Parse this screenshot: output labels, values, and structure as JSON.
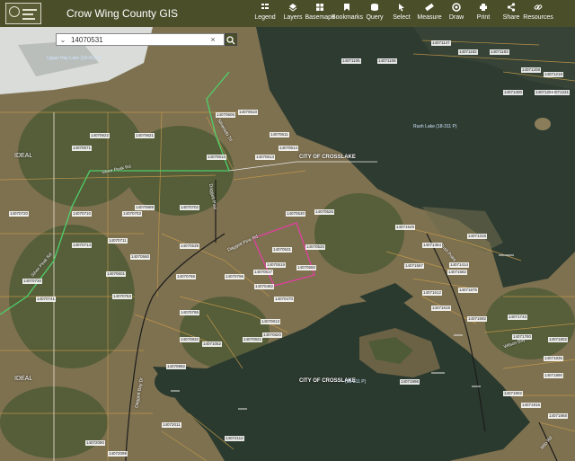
{
  "header": {
    "title": "Crow Wing County GIS",
    "tools": [
      {
        "label": "Legend",
        "icon": "legend-icon"
      },
      {
        "label": "Layers",
        "icon": "layers-icon"
      },
      {
        "label": "Basemaps",
        "icon": "basemaps-icon"
      },
      {
        "label": "Bookmarks",
        "icon": "bookmarks-icon"
      },
      {
        "label": "Query",
        "icon": "query-icon"
      },
      {
        "label": "Select",
        "icon": "select-icon"
      },
      {
        "label": "Measure",
        "icon": "measure-icon"
      },
      {
        "label": "Draw",
        "icon": "draw-icon"
      },
      {
        "label": "Print",
        "icon": "print-icon"
      },
      {
        "label": "Share",
        "icon": "share-icon"
      },
      {
        "label": "Resources",
        "icon": "resources-icon"
      }
    ]
  },
  "search": {
    "value": "14070531"
  },
  "map": {
    "labels": {
      "city_north": "CITY OF CROSSLAKE",
      "city_south": "CITY OF CROSSLAKE",
      "ideal_north": "IDEAL",
      "ideal_south": "IDEAL",
      "lake_east": "Rush Lake (18-311 P)",
      "lake_south": "(18-311 P)",
      "lake_nw": "Upper Hay Lake (18-412 P)",
      "road_silver_peak": "Silver Peak Rd",
      "road_silver_peak_sw": "Silver Peak Rd",
      "road_nw": "Silverado Trl",
      "road_mid": "Daggett Pine Rd",
      "road_mid2": "Daggett Pine",
      "road_west": "Daggett Bay Dr",
      "road_island": "Rush Point",
      "road_se": "Wilson Bay Rd",
      "road_se2": "Milo Rd"
    },
    "parcels": [
      "14070531",
      "14070520",
      "14070519",
      "14070470",
      "14070482",
      "14070550",
      "14070530",
      "14070526",
      "14070517",
      "14070539",
      "14070560",
      "14070601",
      "14070606",
      "14070610",
      "14070611",
      "14070613",
      "14070614",
      "14070615",
      "14070621",
      "14070622",
      "14070671",
      "14070689",
      "14070702",
      "14070703",
      "14070710",
      "14070720",
      "14070711",
      "14070714",
      "14070730",
      "14070741",
      "14070763",
      "14070786",
      "14070795",
      "14070796",
      "14070813",
      "14070820",
      "14070832",
      "14070921",
      "14070992",
      "14071052",
      "14071105",
      "14071108",
      "14071147",
      "14071182",
      "14071183",
      "14071208",
      "14071218",
      "14071231",
      "14071293",
      "14071300",
      "14071318",
      "14071354",
      "14071414",
      "14071549",
      "14071567",
      "14071582",
      "14071612",
      "14071619",
      "14071675",
      "14071692",
      "14071743",
      "14071780",
      "14071802",
      "14071835",
      "14071890",
      "14071902",
      "14071916",
      "14071968",
      "14071996",
      "14072011",
      "14072080",
      "14072099",
      "14072112"
    ],
    "colors": {
      "water": "#2f3a2e",
      "land": "#8c7d5a",
      "parcel_line": "#c79a4a",
      "selected": "#e040a0",
      "road_line": "#1a1a1a",
      "trail": "#4fd06a"
    }
  }
}
